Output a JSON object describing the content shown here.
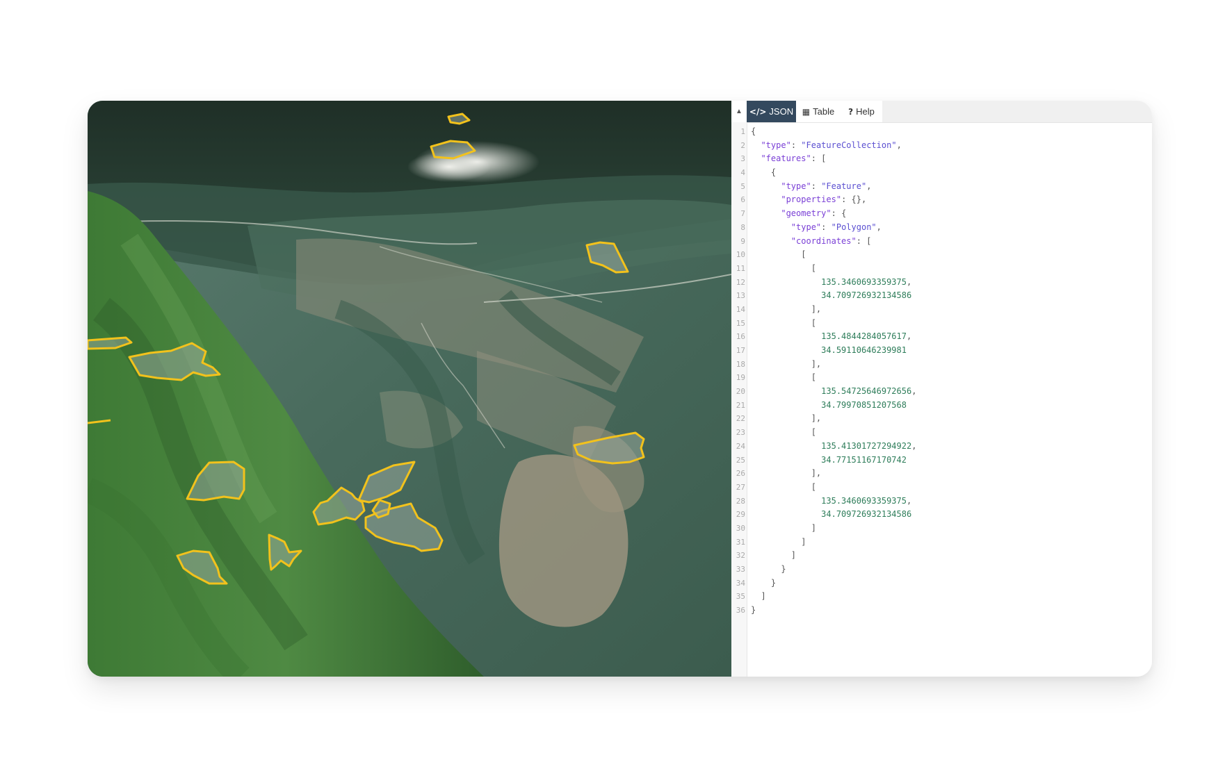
{
  "editor": {
    "tabs": [
      {
        "label": "JSON",
        "icon": "code-icon",
        "active": true
      },
      {
        "label": "Table",
        "icon": "table-icon",
        "active": false
      },
      {
        "label": "Help",
        "icon": "help-icon",
        "active": false
      }
    ],
    "collapse_icon": "triangle-up-icon",
    "code_lines": [
      "{",
      "  \"type\": \"FeatureCollection\",",
      "  \"features\": [",
      "    {",
      "      \"type\": \"Feature\",",
      "      \"properties\": {},",
      "      \"geometry\": {",
      "        \"type\": \"Polygon\",",
      "        \"coordinates\": [",
      "          [",
      "            [",
      "              135.3460693359375,",
      "              34.709726932134586",
      "            ],",
      "            [",
      "              135.4844284057617,",
      "              34.59110646239981",
      "            ],",
      "            [",
      "              135.54725646972656,",
      "              34.79970851207568",
      "            ],",
      "            [",
      "              135.41301727294922,",
      "              34.77151167170742",
      "            ],",
      "            [",
      "              135.3460693359375,",
      "              34.709726932134586",
      "            ]",
      "          ]",
      "        ]",
      "      }",
      "    }",
      "  ]",
      "}"
    ]
  },
  "map": {
    "polygon_stroke": "#f2c21c",
    "polygon_fill": "rgba(150,165,155,0.55)"
  }
}
